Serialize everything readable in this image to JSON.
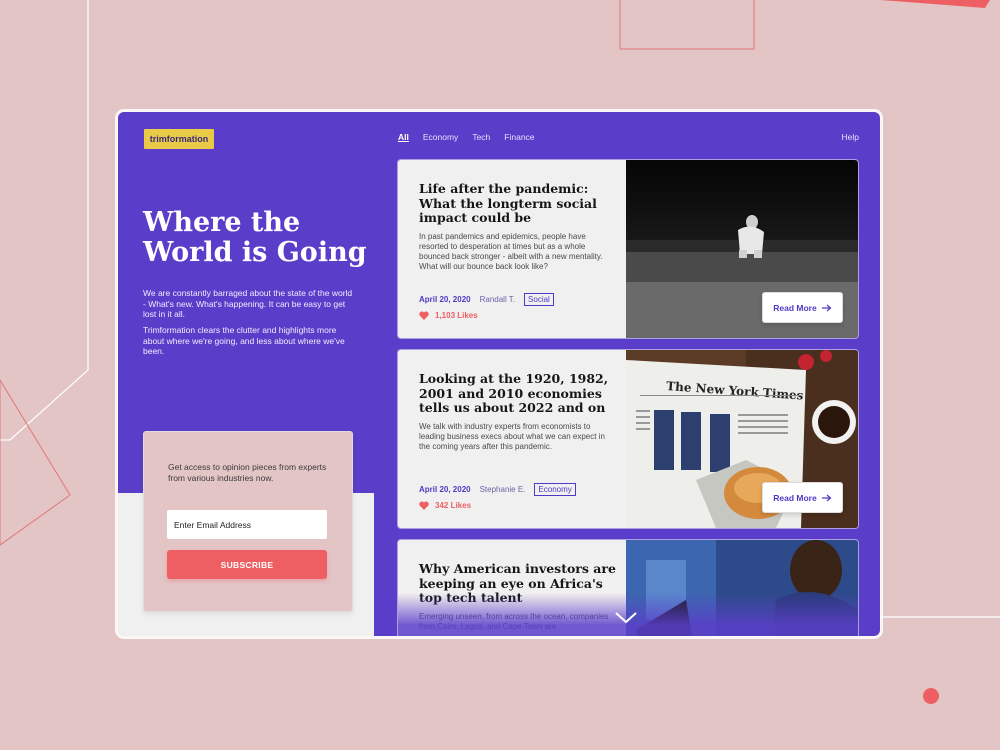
{
  "brand": {
    "logo_text": "trimformation"
  },
  "hero": {
    "title": "Where the World is Going",
    "paragraph1": "We are constantly barraged about the state of the world - What's new. What's happening. It can be easy to get lost in it all.",
    "paragraph2": "Trimformation clears the clutter and highlights more about where we're going, and less about where we've been."
  },
  "subscribe": {
    "text": "Get access to opinion pieces from experts from various industries now.",
    "email_placeholder": "Enter Email Address",
    "button_label": "SUBSCRIBE"
  },
  "nav": {
    "items": [
      {
        "label": "All",
        "active": true
      },
      {
        "label": "Economy",
        "active": false
      },
      {
        "label": "Tech",
        "active": false
      },
      {
        "label": "Finance",
        "active": false
      }
    ],
    "help_label": "Help"
  },
  "articles": [
    {
      "title": "Life after the pandemic: What the longterm social impact could be",
      "summary": "In past pandemics and epidemics, people have resorted to desperation at times but as a whole bounced back stronger - albeit with a new mentality. What will our bounce back look like?",
      "date": "April 20, 2020",
      "author": "Randall T.",
      "tag": "Social",
      "likes": "1,103 Likes",
      "read_more": "Read More"
    },
    {
      "title": "Looking at the 1920, 1982, 2001 and 2010 economies tells us about 2022 and on",
      "summary": "We talk with industry experts from economists to leading business execs about what we can expect in the coming years after this pandemic.",
      "date": "April 20, 2020",
      "author": "Stephanie E.",
      "tag": "Economy",
      "likes": "342 Likes",
      "read_more": "Read More"
    },
    {
      "title": "Why American investors are keeping an eye on Africa's top tech talent",
      "summary": "Emerging unseen, from across the ocean, companies from Cairo, Lagos, and Cape Town are"
    }
  ],
  "newspaper_masthead": "The New York Times",
  "colors": {
    "primary": "#5a3ec9",
    "accent": "#ee5f63",
    "logo_bg": "#eacb47",
    "background": "#e3c5c6"
  }
}
